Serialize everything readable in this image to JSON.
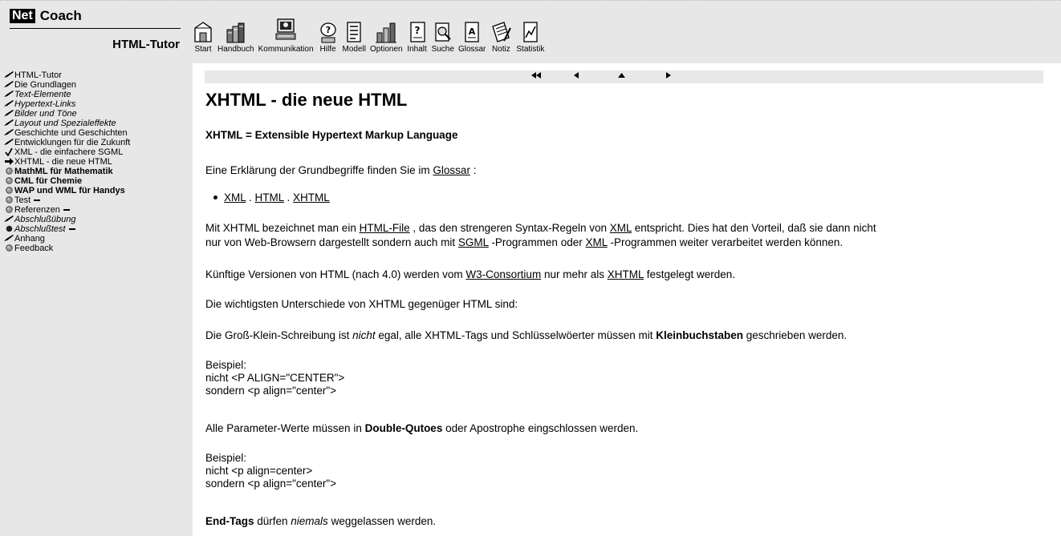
{
  "logo": {
    "brand_box": "Net",
    "brand": "Coach",
    "product": "HTML-Tutor"
  },
  "toolbar": [
    {
      "label": "Start",
      "icon": "start-icon"
    },
    {
      "label": "Handbuch",
      "icon": "handbook-icon"
    },
    {
      "label": "Kommunikation",
      "icon": "communication-icon"
    },
    {
      "label": "Hilfe",
      "icon": "help-icon"
    },
    {
      "label": "Modell",
      "icon": "model-icon"
    },
    {
      "label": "Optionen",
      "icon": "options-icon"
    },
    {
      "label": "Inhalt",
      "icon": "contents-icon"
    },
    {
      "label": "Suche",
      "icon": "search-icon"
    },
    {
      "label": "Glossar",
      "icon": "glossary-icon"
    },
    {
      "label": "Notiz",
      "icon": "note-icon"
    },
    {
      "label": "Statistik",
      "icon": "statistics-icon"
    }
  ],
  "sidebar": {
    "items": [
      {
        "label": "HTML-Tutor",
        "icon": "pen-icon",
        "style": "normal"
      },
      {
        "label": "Die Grundlagen",
        "icon": "pen-icon",
        "style": "normal"
      },
      {
        "label": "Text-Elemente",
        "icon": "pen-icon",
        "style": "italic"
      },
      {
        "label": "Hypertext-Links",
        "icon": "pen-icon",
        "style": "italic"
      },
      {
        "label": "Bilder und Töne",
        "icon": "pen-icon",
        "style": "italic"
      },
      {
        "label": "Layout und Spezialeffekte",
        "icon": "pen-icon",
        "style": "italic"
      },
      {
        "label": "Geschichte und Geschichten",
        "icon": "pen-icon",
        "style": "normal"
      },
      {
        "label": "Entwicklungen für die Zukunft",
        "icon": "pen-icon",
        "style": "normal"
      },
      {
        "label": "XML - die einfachere SGML",
        "icon": "check-icon",
        "style": "normal"
      },
      {
        "label": "XHTML - die neue HTML",
        "icon": "arrow-right-icon",
        "style": "normal"
      },
      {
        "label": "MathML für Mathematik",
        "icon": "bullet-icon",
        "style": "bold"
      },
      {
        "label": "CML für Chemie",
        "icon": "bullet-icon",
        "style": "bold"
      },
      {
        "label": "WAP und WML für Handys",
        "icon": "bullet-icon",
        "style": "bold"
      },
      {
        "label": "Test",
        "icon": "bullet-icon",
        "style": "normal",
        "dash": true
      },
      {
        "label": "Referenzen",
        "icon": "bullet-icon",
        "style": "normal",
        "dash": true
      },
      {
        "label": "Abschlußübung",
        "icon": "pen-icon",
        "style": "italic"
      },
      {
        "label": "Abschlußtest",
        "icon": "bullet-dark-icon",
        "style": "italic",
        "dash": true
      },
      {
        "label": "Anhang",
        "icon": "pen-icon",
        "style": "normal"
      },
      {
        "label": "Feedback",
        "icon": "bullet-icon",
        "style": "normal"
      }
    ]
  },
  "navigation": {
    "first": "◀◀",
    "prev": "◀",
    "up": "▲",
    "next": "▶"
  },
  "content": {
    "title": "XHTML - die neue HTML",
    "subtitle": "XHTML = Extensible Hypertext Markup Language",
    "p1_pre": "Eine Erklärung der Grundbegriffe finden Sie im ",
    "p1_link": "Glossar",
    "p1_post": " :",
    "bullet_xml": "XML",
    "bullet_sep1": " . ",
    "bullet_html": "HTML",
    "bullet_sep2": " . ",
    "bullet_xhtml": "XHTML",
    "p2_a": "Mit XHTML bezeichnet man ein ",
    "p2_link1": "HTML-File",
    "p2_b": " , das den strengeren Syntax-Regeln von ",
    "p2_link2": "XML",
    "p2_c": " entspricht. Dies hat den Vorteil, daß sie dann nicht",
    "p2_d": "nur von Web-Browsern dargestellt sondern auch mit ",
    "p2_link3": "SGML",
    "p2_e": " -Programmen oder ",
    "p2_link4": "XML",
    "p2_f": " -Programmen weiter verarbeitet werden können.",
    "p3_a": "Künftige Versionen von HTML (nach 4.0) werden vom ",
    "p3_link1": "W3-Consortium",
    "p3_b": " nur mehr als ",
    "p3_link2": "XHTML",
    "p3_c": " festgelegt werden.",
    "p4": "Die wichtigsten Unterschiede von XHTML gegenüger HTML sind:",
    "p5_a": "Die Groß-Klein-Schreibung ist ",
    "p5_em": "nicht",
    "p5_b": " egal, alle XHTML-Tags und Schlüsselwöerter müssen mit ",
    "p5_strong": "Kleinbuchstaben",
    "p5_c": " geschrieben werden.",
    "ex1_l1": "Beispiel:",
    "ex1_l2": "nicht <P ALIGN=\"CENTER\">",
    "ex1_l3": "sondern <p align=\"center\">",
    "p6_a": "Alle Parameter-Werte müssen in ",
    "p6_strong": "Double-Qutoes",
    "p6_b": " oder Apostrophe eingschlossen werden.",
    "ex2_l1": "Beispiel:",
    "ex2_l2": "nicht <p align=center>",
    "ex2_l3": "sondern <p align=\"center\">",
    "p7_strong": "End-Tags",
    "p7_a": " dürfen ",
    "p7_em": "niemals",
    "p7_b": " weggelassen werden."
  }
}
